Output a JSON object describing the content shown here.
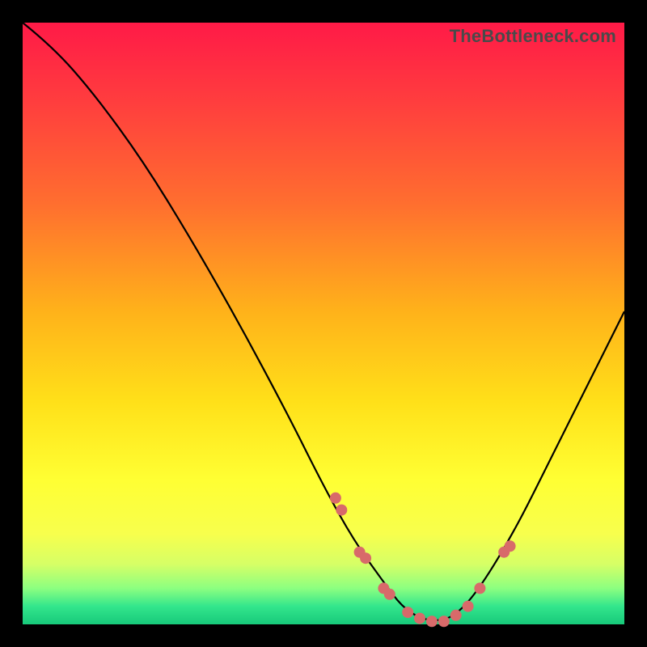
{
  "watermark": "TheBottleneck.com",
  "chart_data": {
    "type": "line",
    "title": "",
    "xlabel": "",
    "ylabel": "",
    "xlim": [
      0,
      100
    ],
    "ylim": [
      0,
      100
    ],
    "axes_visible": false,
    "grid": false,
    "background_gradient": {
      "direction": "vertical",
      "stops": [
        {
          "pos": 0.0,
          "color": "#ff1a47"
        },
        {
          "pos": 0.3,
          "color": "#ff6e2f"
        },
        {
          "pos": 0.63,
          "color": "#ffe019"
        },
        {
          "pos": 0.85,
          "color": "#f7ff4d"
        },
        {
          "pos": 0.97,
          "color": "#33e68c"
        },
        {
          "pos": 1.0,
          "color": "#17c97a"
        }
      ]
    },
    "series": [
      {
        "name": "bottleneck-curve",
        "x": [
          0,
          5,
          12,
          20,
          28,
          36,
          44,
          50,
          55,
          60,
          63,
          66,
          69,
          72,
          76,
          82,
          88,
          94,
          100
        ],
        "y": [
          100,
          96,
          88,
          77,
          64,
          50,
          35,
          23,
          14,
          7,
          3,
          1,
          0.5,
          1.5,
          6,
          16,
          28,
          40,
          52
        ]
      }
    ],
    "markers": {
      "name": "highlight-dots",
      "color": "#d86a6a",
      "points": [
        {
          "x": 52,
          "y": 21
        },
        {
          "x": 53,
          "y": 19
        },
        {
          "x": 56,
          "y": 12
        },
        {
          "x": 57,
          "y": 11
        },
        {
          "x": 60,
          "y": 6
        },
        {
          "x": 61,
          "y": 5
        },
        {
          "x": 64,
          "y": 2
        },
        {
          "x": 66,
          "y": 1
        },
        {
          "x": 68,
          "y": 0.5
        },
        {
          "x": 70,
          "y": 0.5
        },
        {
          "x": 72,
          "y": 1.5
        },
        {
          "x": 74,
          "y": 3
        },
        {
          "x": 76,
          "y": 6
        },
        {
          "x": 80,
          "y": 12
        },
        {
          "x": 81,
          "y": 13
        }
      ]
    }
  }
}
